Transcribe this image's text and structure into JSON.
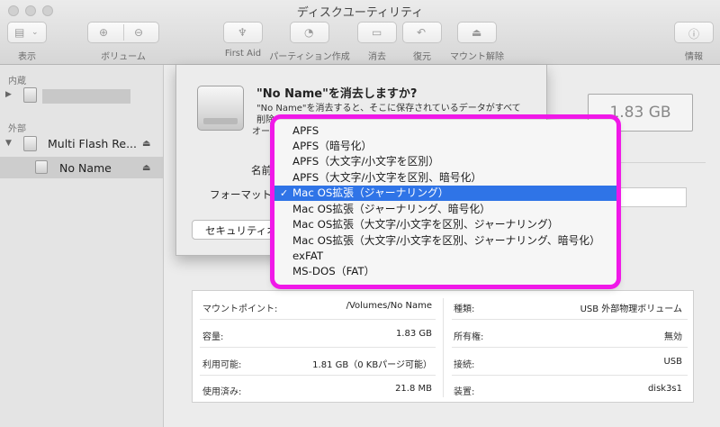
{
  "window": {
    "title": "ディスクユーティリティ"
  },
  "toolbar": {
    "view_label": "表示",
    "volume_label": "ボリューム",
    "first_aid_label": "First Aid",
    "partition_label": "パーティション作成",
    "erase_label": "消去",
    "restore_label": "復元",
    "unmount_label": "マウント解除",
    "info_label": "情報"
  },
  "sidebar": {
    "internal_header": "内蔵",
    "external_header": "外部",
    "external_disk": "Multi Flash Re...",
    "volume_selected": "No Name"
  },
  "main": {
    "size": "1.83 GB"
  },
  "sheet": {
    "title": "\"No Name\"を消去しますか?",
    "desc_line1": "\"No Name\"を消去すると、そこに保存されているデータがすべて",
    "desc_line2": "削除",
    "desc_line3": "オー",
    "name_label": "名前",
    "format_label": "フォーマット",
    "security_button": "セキュリティオ"
  },
  "format_menu": {
    "options": [
      "APFS",
      "APFS（暗号化）",
      "APFS（大文字/小文字を区別）",
      "APFS（大文字/小文字を区別、暗号化）",
      "Mac OS拡張（ジャーナリング）",
      "Mac OS拡張（ジャーナリング、暗号化）",
      "Mac OS拡張（大文字/小文字を区別、ジャーナリング）",
      "Mac OS拡張（大文字/小文字を区別、ジャーナリング、暗号化）",
      "exFAT",
      "MS-DOS（FAT）"
    ],
    "selected_index": 4
  },
  "info": {
    "mount_point_label": "マウントポイント:",
    "mount_point_value": "/Volumes/No Name",
    "capacity_label": "容量:",
    "capacity_value": "1.83 GB",
    "available_label": "利用可能:",
    "available_value": "1.81 GB（0 KBパージ可能）",
    "used_label": "使用済み:",
    "used_value": "21.8 MB",
    "type_label": "種類:",
    "type_value": "USB 外部物理ボリューム",
    "owners_label": "所有権:",
    "owners_value": "無効",
    "connection_label": "接続:",
    "connection_value": "USB",
    "device_label": "装置:",
    "device_value": "disk3s1"
  }
}
